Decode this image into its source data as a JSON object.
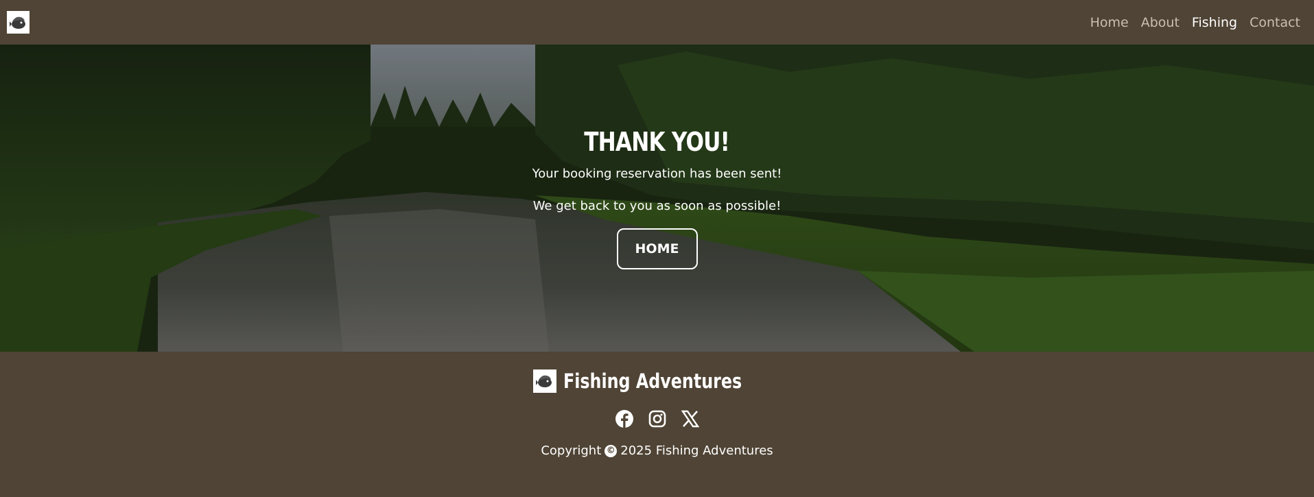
{
  "nav": {
    "logo_icon": "fish-logo-icon",
    "links": [
      {
        "label": "Home",
        "active": false
      },
      {
        "label": "About",
        "active": false
      },
      {
        "label": "Fishing",
        "active": true
      },
      {
        "label": "Contact",
        "active": false
      }
    ]
  },
  "hero": {
    "title": "THANK YOU!",
    "line1": "Your booking reservation has been sent!",
    "line2": "We get back to you as soon as possible!",
    "button_label": "HOME"
  },
  "footer": {
    "brand_name": "Fishing Adventures",
    "social_icons": [
      "facebook-icon",
      "instagram-icon",
      "x-icon"
    ],
    "copyright_prefix": "Copyright",
    "copyright_symbol": "©",
    "copyright_suffix": "2025 Fishing Adventures"
  },
  "colors": {
    "background": "#4f4435",
    "nav_link": "#c9c0b2",
    "nav_link_active": "#ffffff",
    "text": "#ffffff"
  }
}
